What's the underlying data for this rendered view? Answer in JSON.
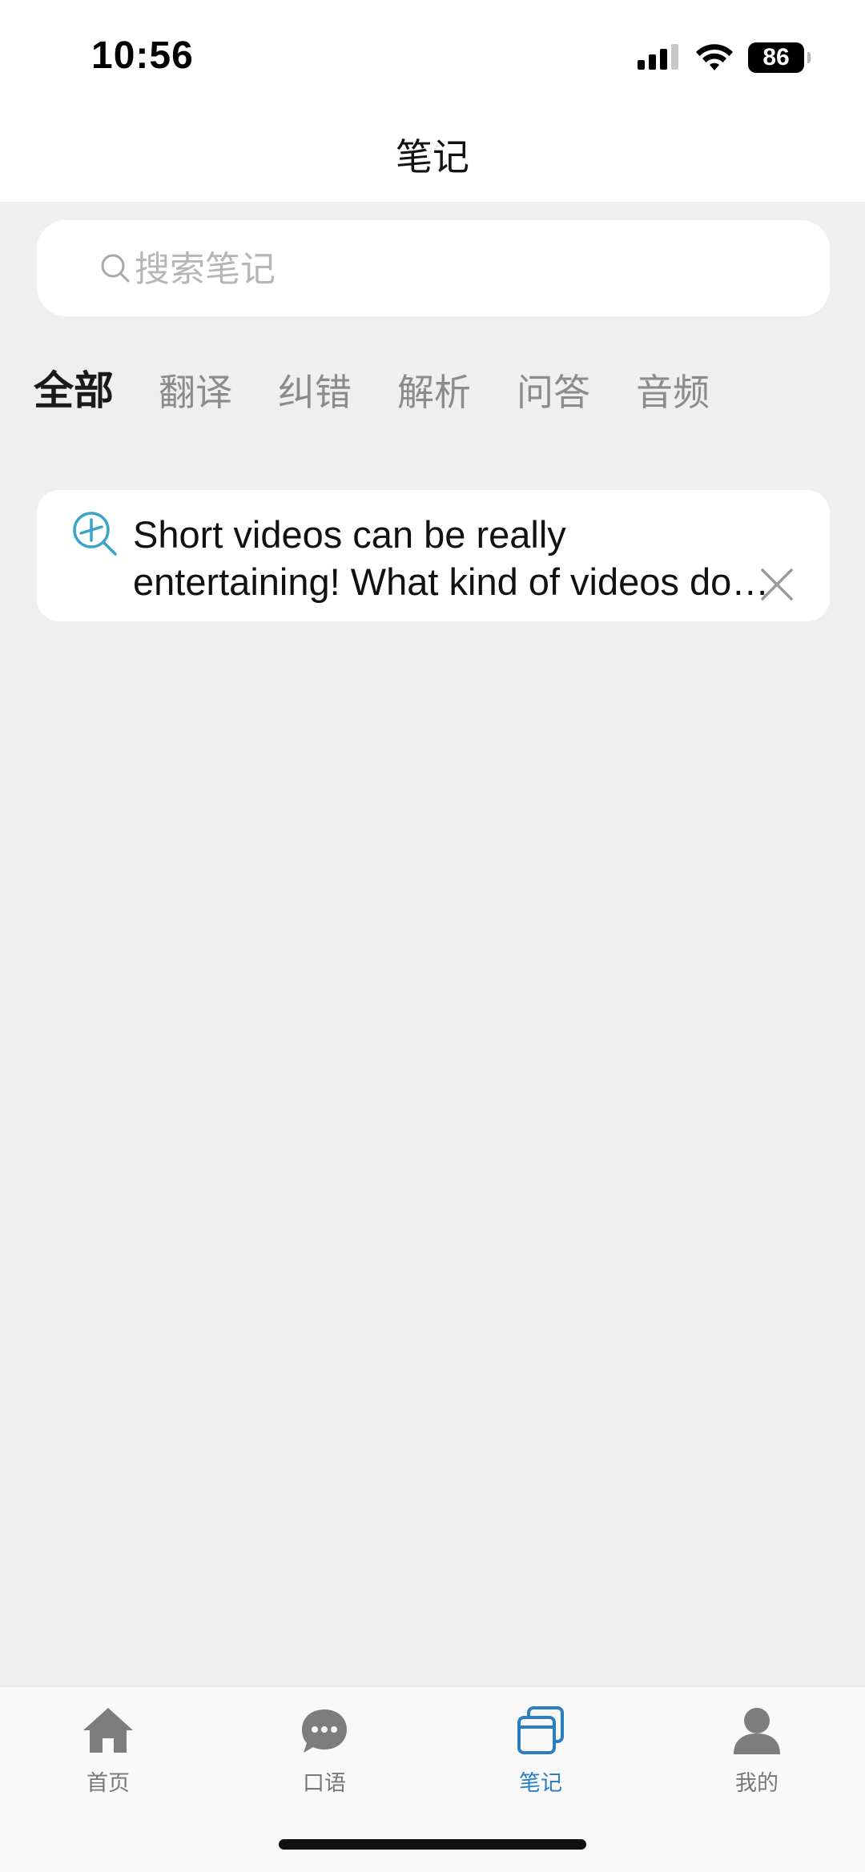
{
  "status_bar": {
    "time": "10:56",
    "battery": "86",
    "icons": [
      "cellular-signal-icon",
      "wifi-icon",
      "battery-icon"
    ]
  },
  "header": {
    "title": "笔记"
  },
  "search": {
    "placeholder": "搜索笔记",
    "value": ""
  },
  "filter_tabs": [
    {
      "label": "全部",
      "active": true
    },
    {
      "label": "翻译",
      "active": false
    },
    {
      "label": "纠错",
      "active": false
    },
    {
      "label": "解析",
      "active": false
    },
    {
      "label": "问答",
      "active": false
    },
    {
      "label": "音频",
      "active": false
    }
  ],
  "notes": [
    {
      "icon": "analysis-magnifier-icon",
      "text": "Short videos can be really entertaining! What kind of videos do you enjoy watching?"
    }
  ],
  "bottom_nav": [
    {
      "label": "首页",
      "icon": "home-icon",
      "active": false
    },
    {
      "label": "口语",
      "icon": "chat-bubble-icon",
      "active": false
    },
    {
      "label": "笔记",
      "icon": "notes-icon",
      "active": true
    },
    {
      "label": "我的",
      "icon": "profile-icon",
      "active": false
    }
  ],
  "colors": {
    "background": "#efeff0",
    "card": "#ffffff",
    "accent": "#2a7fc1",
    "icon_teal": "#3aa4c8",
    "inactive": "#8b8b8b"
  }
}
